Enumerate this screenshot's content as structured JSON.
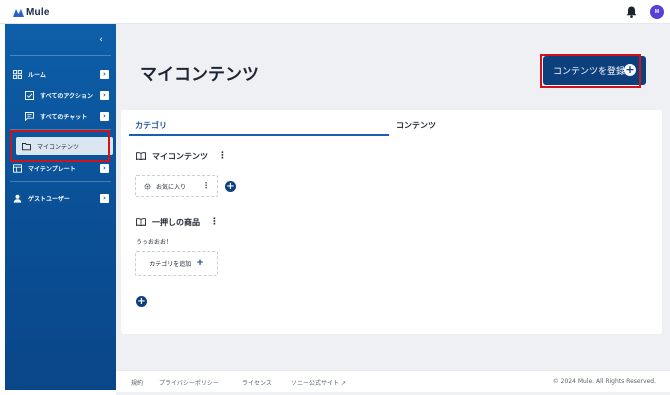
{
  "app": {
    "name": "Mule",
    "avatar_initial": "M"
  },
  "sidebar": {
    "collapse_icon": "chevron-left-icon",
    "items": [
      {
        "label": "ルーム",
        "icon": "grid-icon"
      },
      {
        "label": "すべてのアクション",
        "icon": "checkbox-icon"
      },
      {
        "label": "すべてのチャット",
        "icon": "chat-icon"
      },
      {
        "label": "マイコンテンツ",
        "icon": "folder-icon",
        "active": true
      },
      {
        "label": "マイテンプレート",
        "icon": "template-icon"
      },
      {
        "label": "ゲストユーザー",
        "icon": "user-icon"
      }
    ]
  },
  "main": {
    "title": "マイコンテンツ",
    "register_button": "コンテンツを登録",
    "tabs": {
      "category": "カテゴリ",
      "contents": "コンテンツ"
    },
    "sections": [
      {
        "title": "マイコンテンツ",
        "chips": [
          "お気に入り"
        ]
      },
      {
        "title": "一押しの商品",
        "description": "うぅおおお！",
        "add_category": "カテゴリを追加"
      }
    ]
  },
  "footer": {
    "links": [
      "規約",
      "プライバシーポリシー",
      "ライセンス",
      "ソニー公式サイト"
    ],
    "copyright": "© 2024 Mule. All Rights Reserved."
  },
  "colors": {
    "sidebar": "#0a4f95",
    "accent": "#0c3f7c",
    "highlight": "#d0121b"
  }
}
